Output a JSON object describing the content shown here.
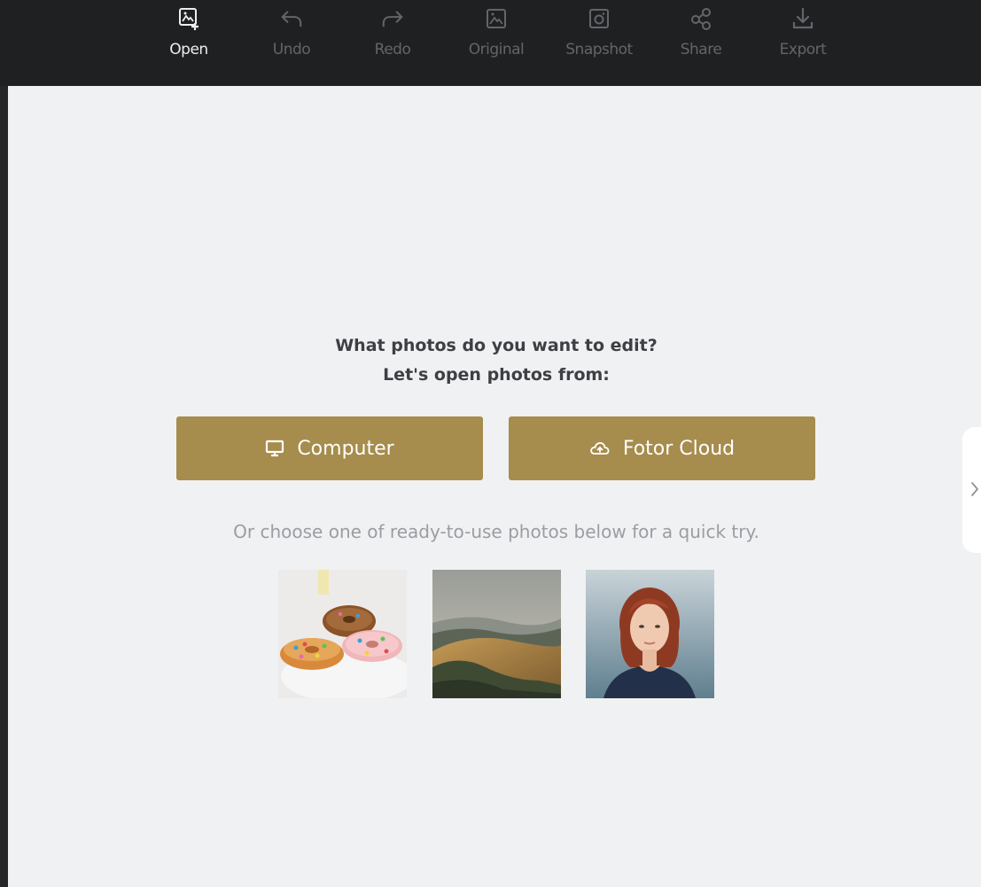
{
  "toolbar": {
    "items": [
      {
        "label": "Open",
        "icon": "image-add-icon",
        "active": true
      },
      {
        "label": "Undo",
        "icon": "undo-icon",
        "active": false
      },
      {
        "label": "Redo",
        "icon": "redo-icon",
        "active": false
      },
      {
        "label": "Original",
        "icon": "image-icon",
        "active": false
      },
      {
        "label": "Snapshot",
        "icon": "snapshot-icon",
        "active": false
      },
      {
        "label": "Share",
        "icon": "share-icon",
        "active": false
      },
      {
        "label": "Export",
        "icon": "download-icon",
        "active": false
      }
    ]
  },
  "main": {
    "prompt_line1": "What photos do you want to edit?",
    "prompt_line2": "Let's open photos from:",
    "computer_button": "Computer",
    "cloud_button": "Fotor Cloud",
    "hint": "Or choose one of ready-to-use photos below for a quick try.",
    "samples": [
      {
        "icon": "donuts-photo"
      },
      {
        "icon": "landscape-photo"
      },
      {
        "icon": "portrait-photo"
      }
    ]
  },
  "colors": {
    "toolbar_bg": "#1f2022",
    "canvas_bg": "#f0f1f2",
    "accent_button": "#a68c4d",
    "inactive_label": "#63656a",
    "active_label": "#eceef0"
  }
}
